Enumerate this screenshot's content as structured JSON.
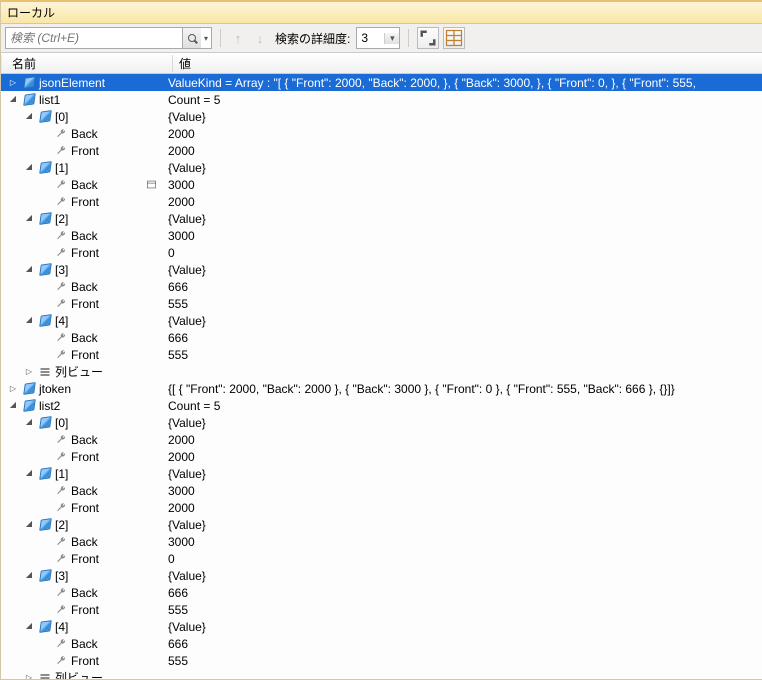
{
  "window": {
    "title": "ローカル"
  },
  "toolbar": {
    "search_placeholder": "検索 (Ctrl+E)",
    "depth_label": "検索の詳細度:",
    "depth_value": "3"
  },
  "columns": {
    "name": "名前",
    "value": "値"
  },
  "rows": [
    {
      "depth": 0,
      "tw": "closed",
      "icon": "cube",
      "name": "jsonElement",
      "value": "ValueKind = Array : \"[    {        \"Front\": 2000,        \"Back\": 2000,    },    {        \"Back\": 3000,    },    {        \"Front\": 0,    },    {        \"Front\": 555,",
      "selected": true
    },
    {
      "depth": 0,
      "tw": "open",
      "icon": "cube",
      "name": "list1",
      "value": "Count = 5"
    },
    {
      "depth": 1,
      "tw": "open",
      "icon": "cube",
      "name": "[0]",
      "value": "{Value}"
    },
    {
      "depth": 2,
      "tw": "none",
      "icon": "wrench",
      "name": "Back",
      "value": "2000"
    },
    {
      "depth": 2,
      "tw": "none",
      "icon": "wrench",
      "name": "Front",
      "value": "2000"
    },
    {
      "depth": 1,
      "tw": "open",
      "icon": "cube",
      "name": "[1]",
      "value": "{Value}"
    },
    {
      "depth": 2,
      "tw": "none",
      "icon": "wrench",
      "name": "Back",
      "value": "3000",
      "vis": true
    },
    {
      "depth": 2,
      "tw": "none",
      "icon": "wrench",
      "name": "Front",
      "value": "2000"
    },
    {
      "depth": 1,
      "tw": "open",
      "icon": "cube",
      "name": "[2]",
      "value": "{Value}"
    },
    {
      "depth": 2,
      "tw": "none",
      "icon": "wrench",
      "name": "Back",
      "value": "3000"
    },
    {
      "depth": 2,
      "tw": "none",
      "icon": "wrench",
      "name": "Front",
      "value": "0"
    },
    {
      "depth": 1,
      "tw": "open",
      "icon": "cube",
      "name": "[3]",
      "value": "{Value}"
    },
    {
      "depth": 2,
      "tw": "none",
      "icon": "wrench",
      "name": "Back",
      "value": "666"
    },
    {
      "depth": 2,
      "tw": "none",
      "icon": "wrench",
      "name": "Front",
      "value": "555"
    },
    {
      "depth": 1,
      "tw": "open",
      "icon": "cube",
      "name": "[4]",
      "value": "{Value}"
    },
    {
      "depth": 2,
      "tw": "none",
      "icon": "wrench",
      "name": "Back",
      "value": "666"
    },
    {
      "depth": 2,
      "tw": "none",
      "icon": "wrench",
      "name": "Front",
      "value": "555"
    },
    {
      "depth": 1,
      "tw": "closed",
      "icon": "rows",
      "name": "列ビュー",
      "value": ""
    },
    {
      "depth": 0,
      "tw": "closed",
      "icon": "cube",
      "name": "jtoken",
      "value": "{[   {      \"Front\": 2000,      \"Back\": 2000   },   {      \"Back\": 3000   },   {      \"Front\": 0   },   {      \"Front\": 555,      \"Back\": 666   },   {}]}"
    },
    {
      "depth": 0,
      "tw": "open",
      "icon": "cube",
      "name": "list2",
      "value": "Count = 5"
    },
    {
      "depth": 1,
      "tw": "open",
      "icon": "cube",
      "name": "[0]",
      "value": "{Value}"
    },
    {
      "depth": 2,
      "tw": "none",
      "icon": "wrench",
      "name": "Back",
      "value": "2000"
    },
    {
      "depth": 2,
      "tw": "none",
      "icon": "wrench",
      "name": "Front",
      "value": "2000"
    },
    {
      "depth": 1,
      "tw": "open",
      "icon": "cube",
      "name": "[1]",
      "value": "{Value}"
    },
    {
      "depth": 2,
      "tw": "none",
      "icon": "wrench",
      "name": "Back",
      "value": "3000"
    },
    {
      "depth": 2,
      "tw": "none",
      "icon": "wrench",
      "name": "Front",
      "value": "2000"
    },
    {
      "depth": 1,
      "tw": "open",
      "icon": "cube",
      "name": "[2]",
      "value": "{Value}"
    },
    {
      "depth": 2,
      "tw": "none",
      "icon": "wrench",
      "name": "Back",
      "value": "3000"
    },
    {
      "depth": 2,
      "tw": "none",
      "icon": "wrench",
      "name": "Front",
      "value": "0"
    },
    {
      "depth": 1,
      "tw": "open",
      "icon": "cube",
      "name": "[3]",
      "value": "{Value}"
    },
    {
      "depth": 2,
      "tw": "none",
      "icon": "wrench",
      "name": "Back",
      "value": "666"
    },
    {
      "depth": 2,
      "tw": "none",
      "icon": "wrench",
      "name": "Front",
      "value": "555"
    },
    {
      "depth": 1,
      "tw": "open",
      "icon": "cube",
      "name": "[4]",
      "value": "{Value}"
    },
    {
      "depth": 2,
      "tw": "none",
      "icon": "wrench",
      "name": "Back",
      "value": "666"
    },
    {
      "depth": 2,
      "tw": "none",
      "icon": "wrench",
      "name": "Front",
      "value": "555"
    },
    {
      "depth": 1,
      "tw": "closed",
      "icon": "rows",
      "name": "列ビュー",
      "value": ""
    }
  ]
}
